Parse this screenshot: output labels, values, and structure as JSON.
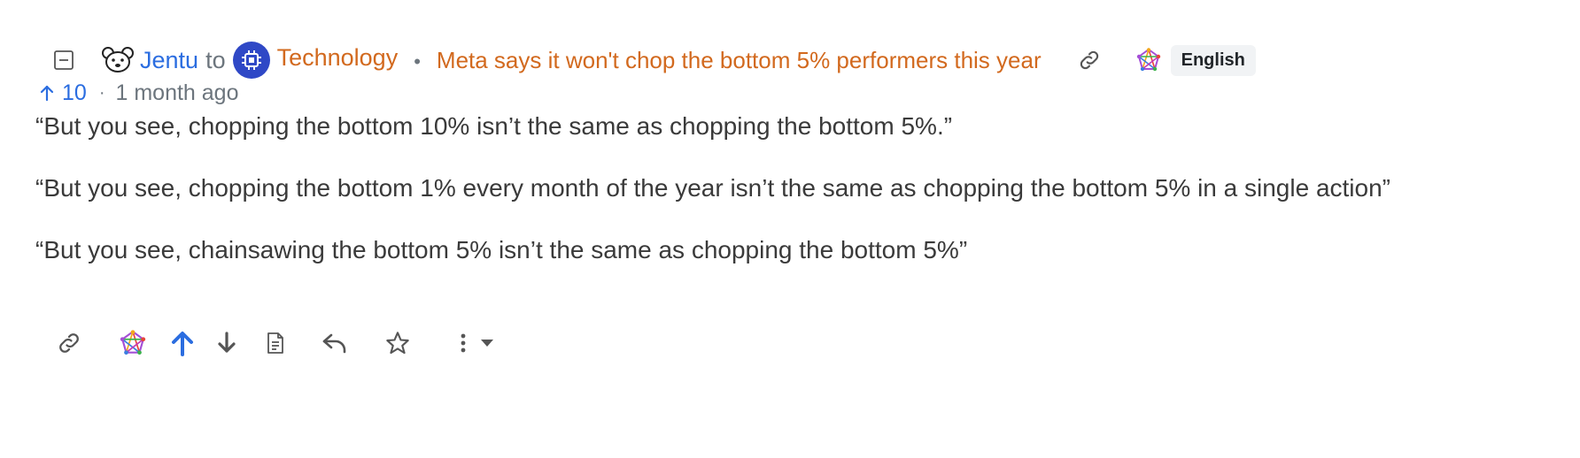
{
  "comment": {
    "author": "Jentu",
    "to_word": "to",
    "community": "Technology",
    "separator": "•",
    "post_title": "Meta says it won't chop the bottom 5% performers this year",
    "language": "English",
    "score": "10",
    "meta_separator": "·",
    "time_ago": "1 month ago",
    "paragraphs": [
      "“But you see, chopping the bottom 10% isn’t the same as chopping the bottom 5%.”",
      "“But you see, chopping the bottom 1% every month of the year isn’t the same as chopping the bottom 5% in a single action”",
      "“But you see, chainsawing the bottom 5% isn’t the same as chopping the bottom 5%”"
    ]
  },
  "icons": {
    "collapse": "collapse-minus-icon",
    "avatar": "bear-avatar-icon",
    "community": "chip-icon",
    "link": "link-icon",
    "fediverse": "fediverse-icon",
    "upvote": "arrow-up-icon",
    "downvote": "arrow-down-icon",
    "view_source": "document-icon",
    "reply": "reply-icon",
    "save": "star-icon",
    "more": "more-vertical-icon",
    "dropdown": "caret-down-icon"
  },
  "colors": {
    "user_link": "#2b6de0",
    "community_link": "#d2691e",
    "post_link": "#d2691e",
    "upvote_active": "#2b6de0",
    "muted": "#6c757d",
    "community_bg": "#2f48c6"
  }
}
